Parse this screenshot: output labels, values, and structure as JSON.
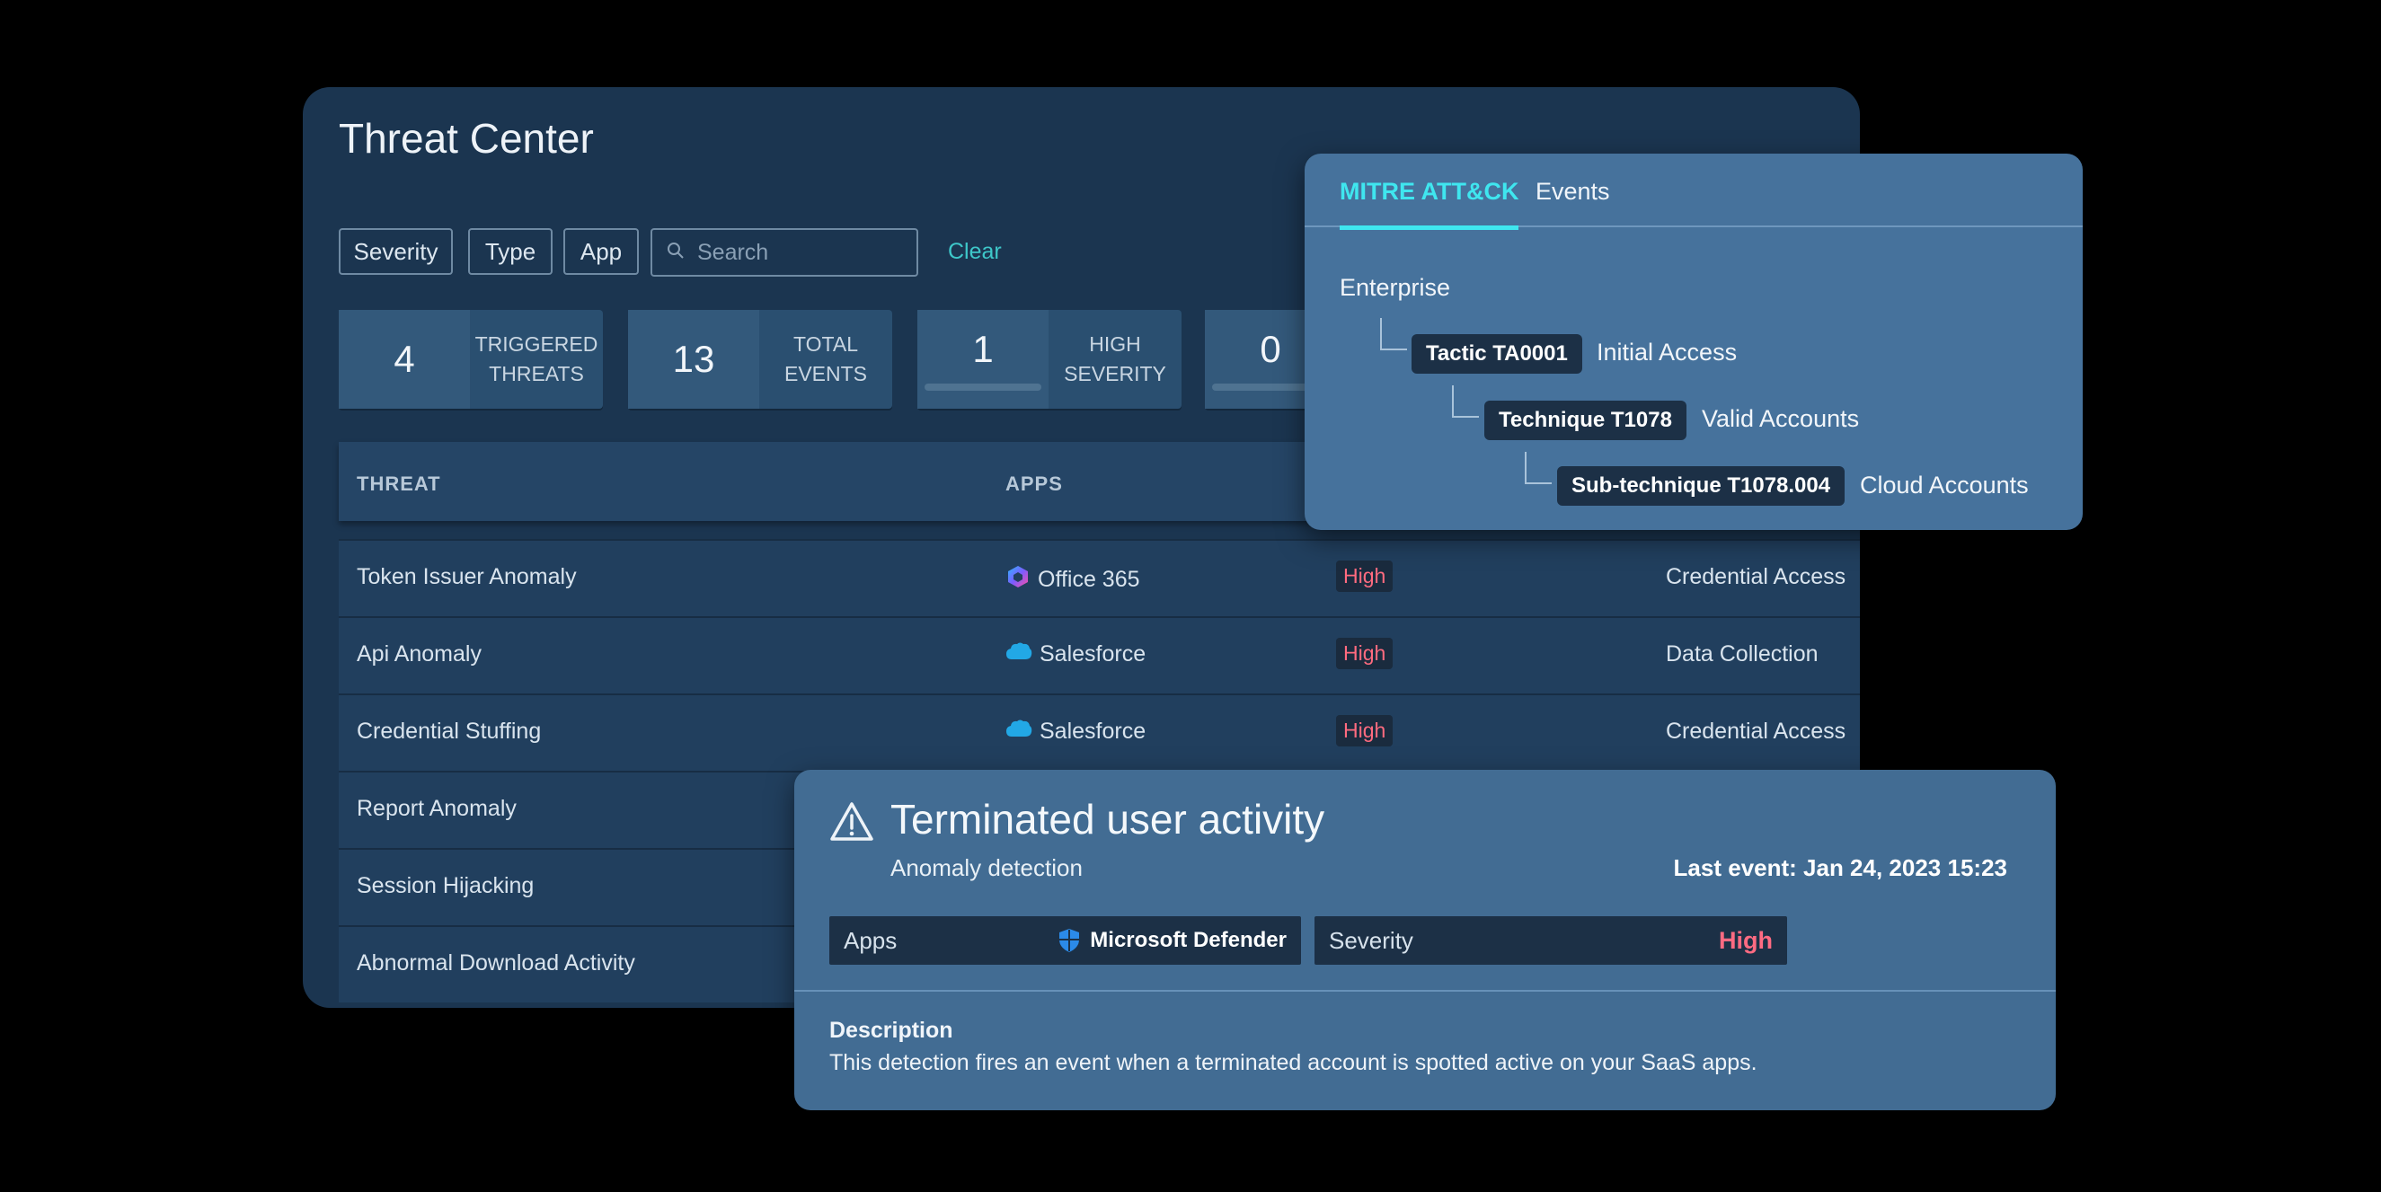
{
  "threat_center": {
    "title": "Threat Center",
    "filters": [
      "Severity",
      "Type",
      "App"
    ],
    "search_placeholder": "Search",
    "clear_label": "Clear",
    "stats": [
      {
        "value": "4",
        "label_line1": "TRIGGERED",
        "label_line2": "THREATS"
      },
      {
        "value": "13",
        "label_line1": "TOTAL",
        "label_line2": "EVENTS"
      },
      {
        "value": "1",
        "label_line1": "HIGH",
        "label_line2": "SEVERITY"
      },
      {
        "value": "0"
      }
    ],
    "table": {
      "headers": {
        "threat": "THREAT",
        "apps": "APPS"
      },
      "rows": [
        {
          "threat": "Token Issuer Anomaly",
          "app": "Office 365",
          "severity": "High",
          "category": "Credential Access"
        },
        {
          "threat": "Api Anomaly",
          "app": "Salesforce",
          "severity": "High",
          "category": "Data Collection"
        },
        {
          "threat": "Credential Stuffing",
          "app": "Salesforce",
          "severity": "High",
          "category": "Credential Access"
        },
        {
          "threat": "Report Anomaly"
        },
        {
          "threat": "Session Hijacking"
        },
        {
          "threat": "Abnormal Download Activity"
        }
      ]
    }
  },
  "mitre_panel": {
    "tabs": [
      {
        "label": "MITRE ATT&CK",
        "active": true
      },
      {
        "label": "Events",
        "active": false
      }
    ],
    "enterprise": "Enterprise",
    "nodes": [
      {
        "badge": "Tactic TA0001",
        "text": "Initial Access"
      },
      {
        "badge": "Technique T1078",
        "text": "Valid Accounts"
      },
      {
        "badge": "Sub-technique T1078.004",
        "text": "Cloud Accounts"
      }
    ]
  },
  "terminated_panel": {
    "title": "Terminated user activity",
    "subtitle": "Anomaly detection",
    "last_event": "Last event: Jan 24, 2023 15:23",
    "apps_label": "Apps",
    "apps_value": "Microsoft Defender",
    "severity_label": "Severity",
    "severity_value": "High",
    "description_title": "Description",
    "description_text": "This detection fires an event when a terminated account is spotted active on your SaaS apps."
  },
  "colors": {
    "accent_teal": "#3fe6ef",
    "clear_link": "#3ec7c9",
    "severity_high": "#ff6b7f",
    "panel_bg": "#1b3550",
    "overlay_bg": "#46729c"
  },
  "icons": {
    "search": "search-icon",
    "office365": "office365-icon",
    "salesforce": "salesforce-cloud-icon",
    "warning": "warning-triangle-icon",
    "defender": "shield-icon"
  }
}
